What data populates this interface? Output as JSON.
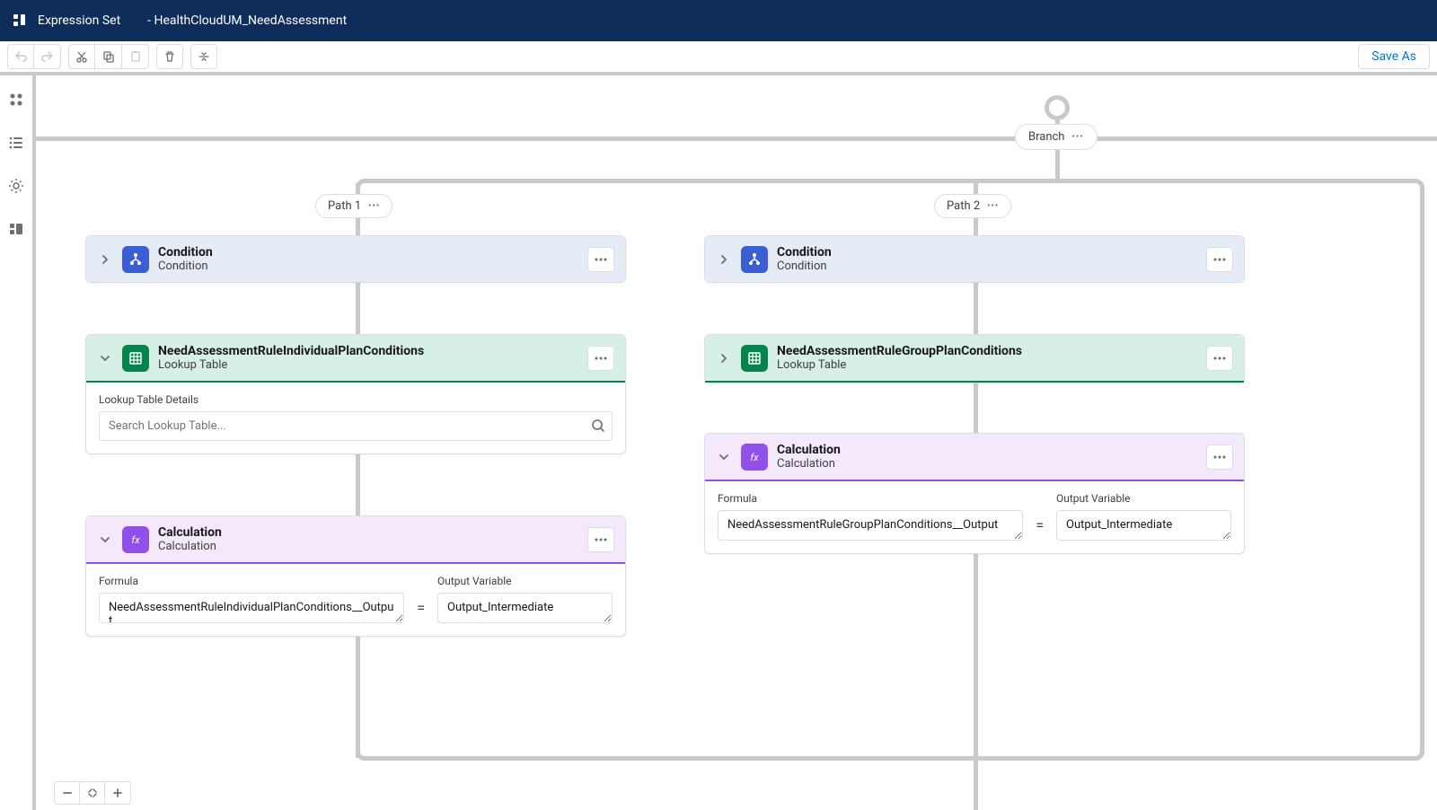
{
  "header": {
    "app_label": "Expression Set",
    "record_name": "- HealthCloudUM_NeedAssessment"
  },
  "toolbar": {
    "save_as": "Save As"
  },
  "branch": {
    "label": "Branch",
    "path1": "Path 1",
    "path2": "Path 2"
  },
  "nodes": {
    "cond1": {
      "title": "Condition",
      "sub": "Condition"
    },
    "cond2": {
      "title": "Condition",
      "sub": "Condition"
    },
    "look1": {
      "title": "NeedAssessmentRuleIndividualPlanConditions",
      "sub": "Lookup Table"
    },
    "look1_body": {
      "section_label": "Lookup Table Details",
      "search_placeholder": "Search Lookup Table..."
    },
    "look2": {
      "title": "NeedAssessmentRuleGroupPlanConditions",
      "sub": "Lookup Table"
    },
    "calc1": {
      "title": "Calculation",
      "sub": "Calculation",
      "formula_label": "Formula",
      "output_label": "Output Variable",
      "formula_value": "NeedAssessmentRuleIndividualPlanConditions__Output",
      "output_value": "Output_Intermediate"
    },
    "calc2": {
      "title": "Calculation",
      "sub": "Calculation",
      "formula_label": "Formula",
      "output_label": "Output Variable",
      "formula_value": "NeedAssessmentRuleGroupPlanConditions__Output",
      "output_value": "Output_Intermediate"
    }
  },
  "eq": "="
}
